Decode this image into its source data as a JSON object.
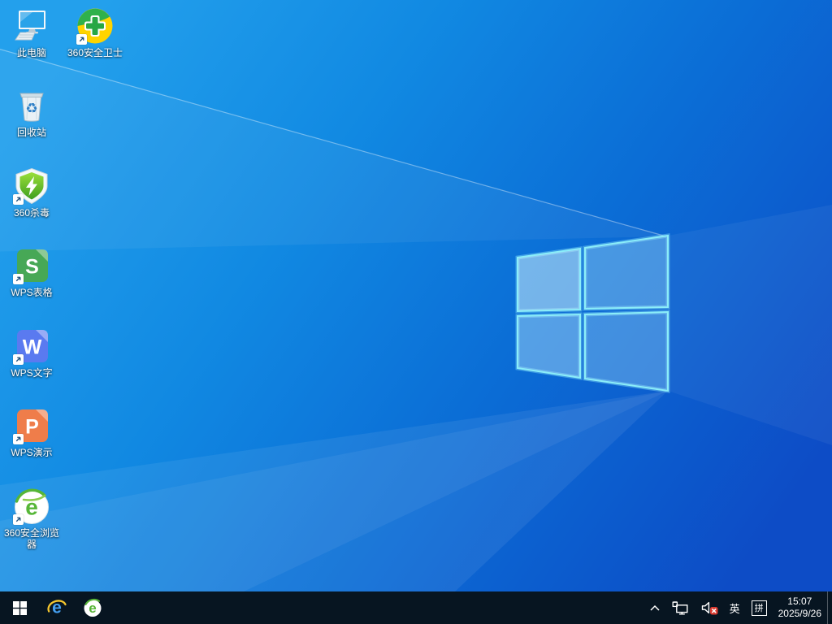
{
  "wallpaper": {
    "base_left_color": "#23a0ec",
    "base_right_color": "#0d4cc6",
    "logo_edge_color": "#8beef9"
  },
  "desktop": {
    "icons": [
      {
        "id": "this-pc",
        "label": "此电脑",
        "shortcut": false
      },
      {
        "id": "360-safe-guard",
        "label": "360安全卫士",
        "shortcut": true,
        "color": "#ffd400"
      },
      {
        "id": "recycle-bin",
        "label": "回收站",
        "shortcut": false,
        "glyph": "♻"
      },
      {
        "id": "360-antivirus",
        "label": "360杀毒",
        "shortcut": true,
        "color": "#5cb82e"
      },
      {
        "id": "wps-spreadsheet",
        "label": "WPS表格",
        "shortcut": true,
        "letter": "S",
        "color": "#47a856"
      },
      {
        "id": "wps-writer",
        "label": "WPS文字",
        "shortcut": true,
        "letter": "W",
        "color": "#5a7af0"
      },
      {
        "id": "wps-presentation",
        "label": "WPS演示",
        "shortcut": true,
        "letter": "P",
        "color": "#ef7d4a"
      },
      {
        "id": "360-browser",
        "label": "360安全浏览器",
        "shortcut": true,
        "glyph": "e",
        "color": "#56b637"
      }
    ]
  },
  "taskbar": {
    "background": "#071521",
    "pinned": [
      {
        "id": "internet-explorer",
        "glyph": "e",
        "color": "#45a0f2"
      },
      {
        "id": "360-secure-browser",
        "glyph": "e",
        "color": "#55b335"
      }
    ],
    "tray": {
      "ime_latin": "英",
      "ime_pinyin": "拼",
      "time": "15:07",
      "date": "2025/9/26"
    }
  }
}
